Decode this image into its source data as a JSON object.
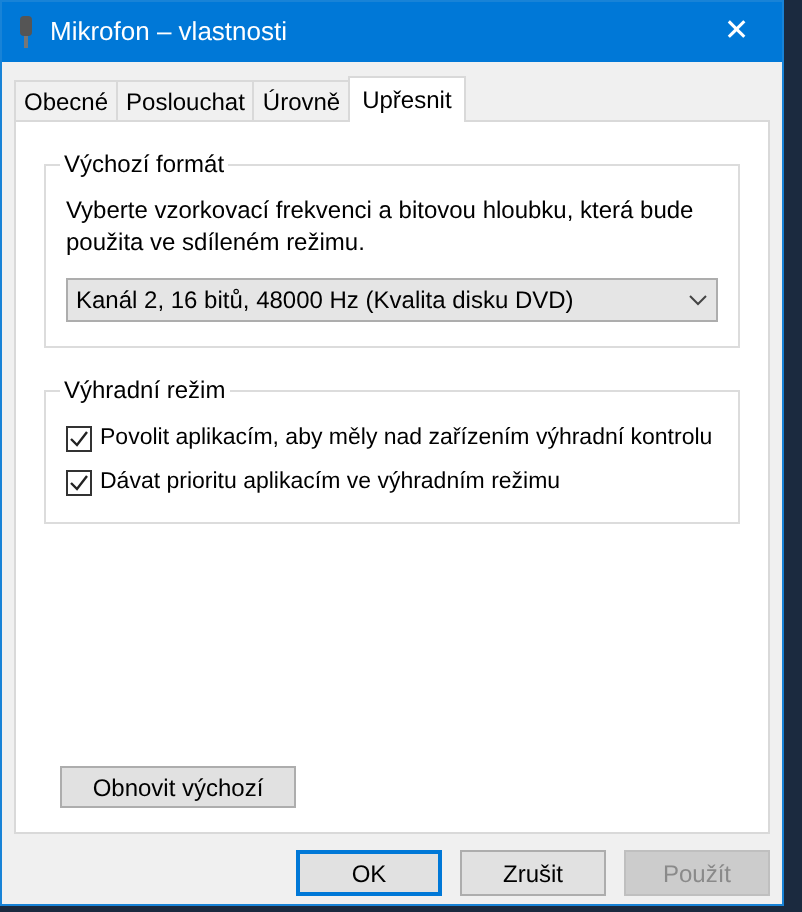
{
  "window": {
    "title": "Mikrofon – vlastnosti",
    "close": "✕"
  },
  "tabs": [
    {
      "label": "Obecné",
      "selected": false
    },
    {
      "label": "Poslouchat",
      "selected": false
    },
    {
      "label": "Úrovně",
      "selected": false
    },
    {
      "label": "Upřesnit",
      "selected": true
    }
  ],
  "default_format": {
    "title": "Výchozí formát",
    "description": "Vyberte vzorkovací frekvenci a bitovou hloubku, která bude použita ve sdíleném režimu.",
    "value": "Kanál 2, 16 bitů, 48000 Hz (Kvalita disku DVD)"
  },
  "exclusive_mode": {
    "title": "Výhradní režim",
    "options": [
      {
        "label": "Povolit aplikacím, aby měly nad zařízením výhradní kontrolu",
        "checked": true
      },
      {
        "label": "Dávat prioritu aplikacím ve výhradním režimu",
        "checked": true
      }
    ]
  },
  "restore_button": "Obnovit výchozí",
  "buttons": [
    {
      "label": "OK",
      "kind": "default",
      "disabled": false
    },
    {
      "label": "Zrušit",
      "kind": "normal",
      "disabled": false
    },
    {
      "label": "Použít",
      "kind": "normal",
      "disabled": true
    }
  ]
}
